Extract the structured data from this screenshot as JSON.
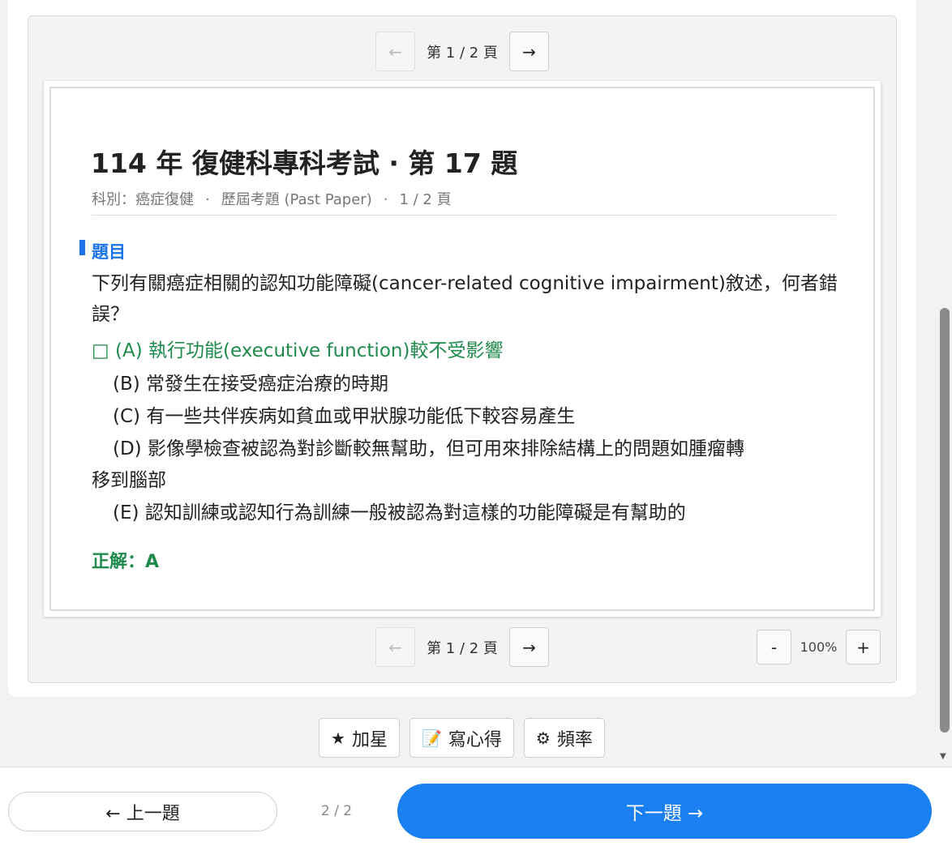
{
  "viewer": {
    "pager": {
      "prev_symbol": "←",
      "next_symbol": "→",
      "label": "第 1 / 2 頁"
    },
    "zoom": {
      "minus": "-",
      "plus": "+",
      "value": "100%"
    }
  },
  "document": {
    "title": "114 年 復健科專科考試 · 第 17 題",
    "meta": {
      "subject": "科別：癌症復健",
      "separator": "·",
      "source": "歷屆考題 (Past Paper)",
      "page": "1 / 2 頁"
    },
    "section_label": "題目",
    "question": "下列有關癌症相關的認知功能障礙(cancer-related cognitive impairment)敘述，何者錯誤？",
    "options": {
      "a": "□ (A) 執行功能(executive function)較不受影響",
      "b": "(B) 常發生在接受癌症治療的時期",
      "c": "(C) 有一些共伴疾病如貧血或甲狀腺功能低下較容易產生",
      "d_line1": "(D) 影像學檢查被認為對診斷較無幫助，但可用來排除結構上的問題如腫瘤轉",
      "d_line2": "移到腦部",
      "e": "(E) 認知訓練或認知行為訓練一般被認為對這樣的功能障礙是有幫助的"
    },
    "answer": "正解：A"
  },
  "actions": {
    "star_icon": "★",
    "star_label": "加星",
    "note_icon": "📝",
    "note_label": "寫心得",
    "freq_icon": "⚙",
    "freq_label": "頻率"
  },
  "nav": {
    "prev": "← 上一題",
    "counter": "2 / 2",
    "next": "下一題 →"
  },
  "colors": {
    "accent": "#1a7ff0",
    "section": "#1a73e8",
    "correct": "#1f8a4c"
  }
}
